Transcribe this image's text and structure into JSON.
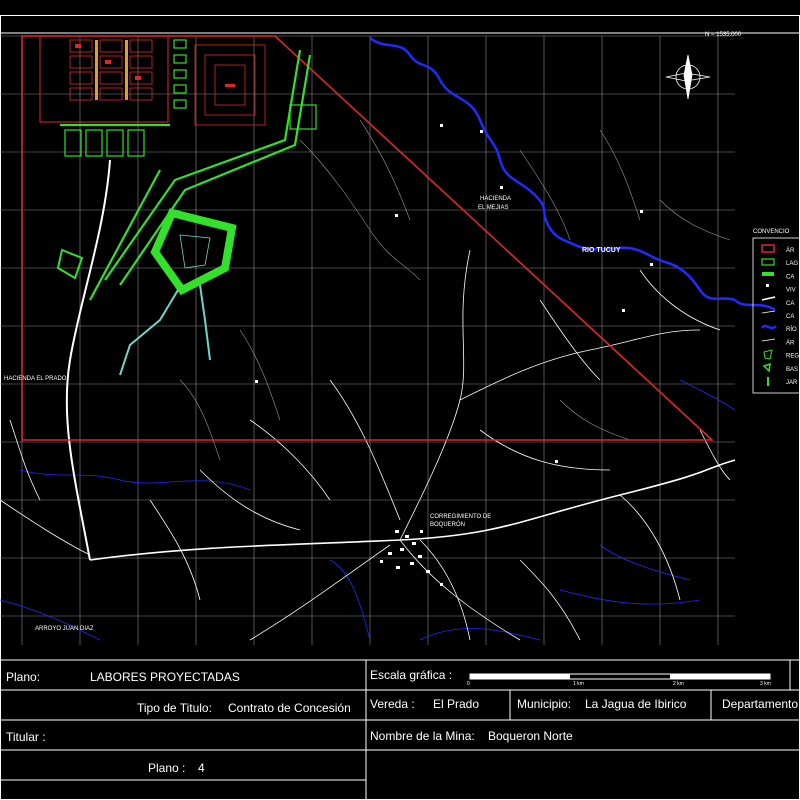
{
  "map": {
    "labels": {
      "hacienda": "HACIENDA",
      "hacienda_sub": "EL MEJIAS",
      "rio": "RIO TUCUY",
      "corregimiento": "CORREGIMIENTO DE",
      "corregimiento_sub": "BOQUERÓN",
      "hacienda_prado": "HACIENDA EL PRADO",
      "arroyo": "ARROYO JUAN DIAZ",
      "north_top": "N = 1535.000"
    },
    "legend": {
      "title": "CONVENCIO",
      "items": [
        "ÁR",
        "LAG",
        "CA",
        "VIV",
        "CA",
        "CA",
        "RÍO",
        "ÁR",
        "REG",
        "BAS",
        "JAR"
      ]
    },
    "colors": {
      "boundary": "#e0262b",
      "river": "#1f2bff",
      "road": "#ffffff",
      "drain": "#6ed6c8",
      "plant": "#33e02a",
      "grid": "#8a8a8a"
    }
  },
  "title_block": {
    "plano_label": "Plano:",
    "plano_value": "LABORES PROYECTADAS",
    "escala_label": "Escala gráfica :",
    "scale_ticks": [
      "0",
      "1 km",
      "2 km",
      "3 km"
    ],
    "tipo_label": "Tipo de Titulo:",
    "tipo_value": "Contrato de Concesión",
    "vereda_label": "Vereda :",
    "vereda_value": "El Prado",
    "municipio_label": "Municipio:",
    "municipio_value": "La Jagua de Ibirico",
    "departamento_label": "Departamento",
    "titular_label": "Titular :",
    "mina_label": "Nombre de la Mina:",
    "mina_value": "Boqueron Norte",
    "plano_num_label": "Plano :",
    "plano_num_value": "4"
  }
}
